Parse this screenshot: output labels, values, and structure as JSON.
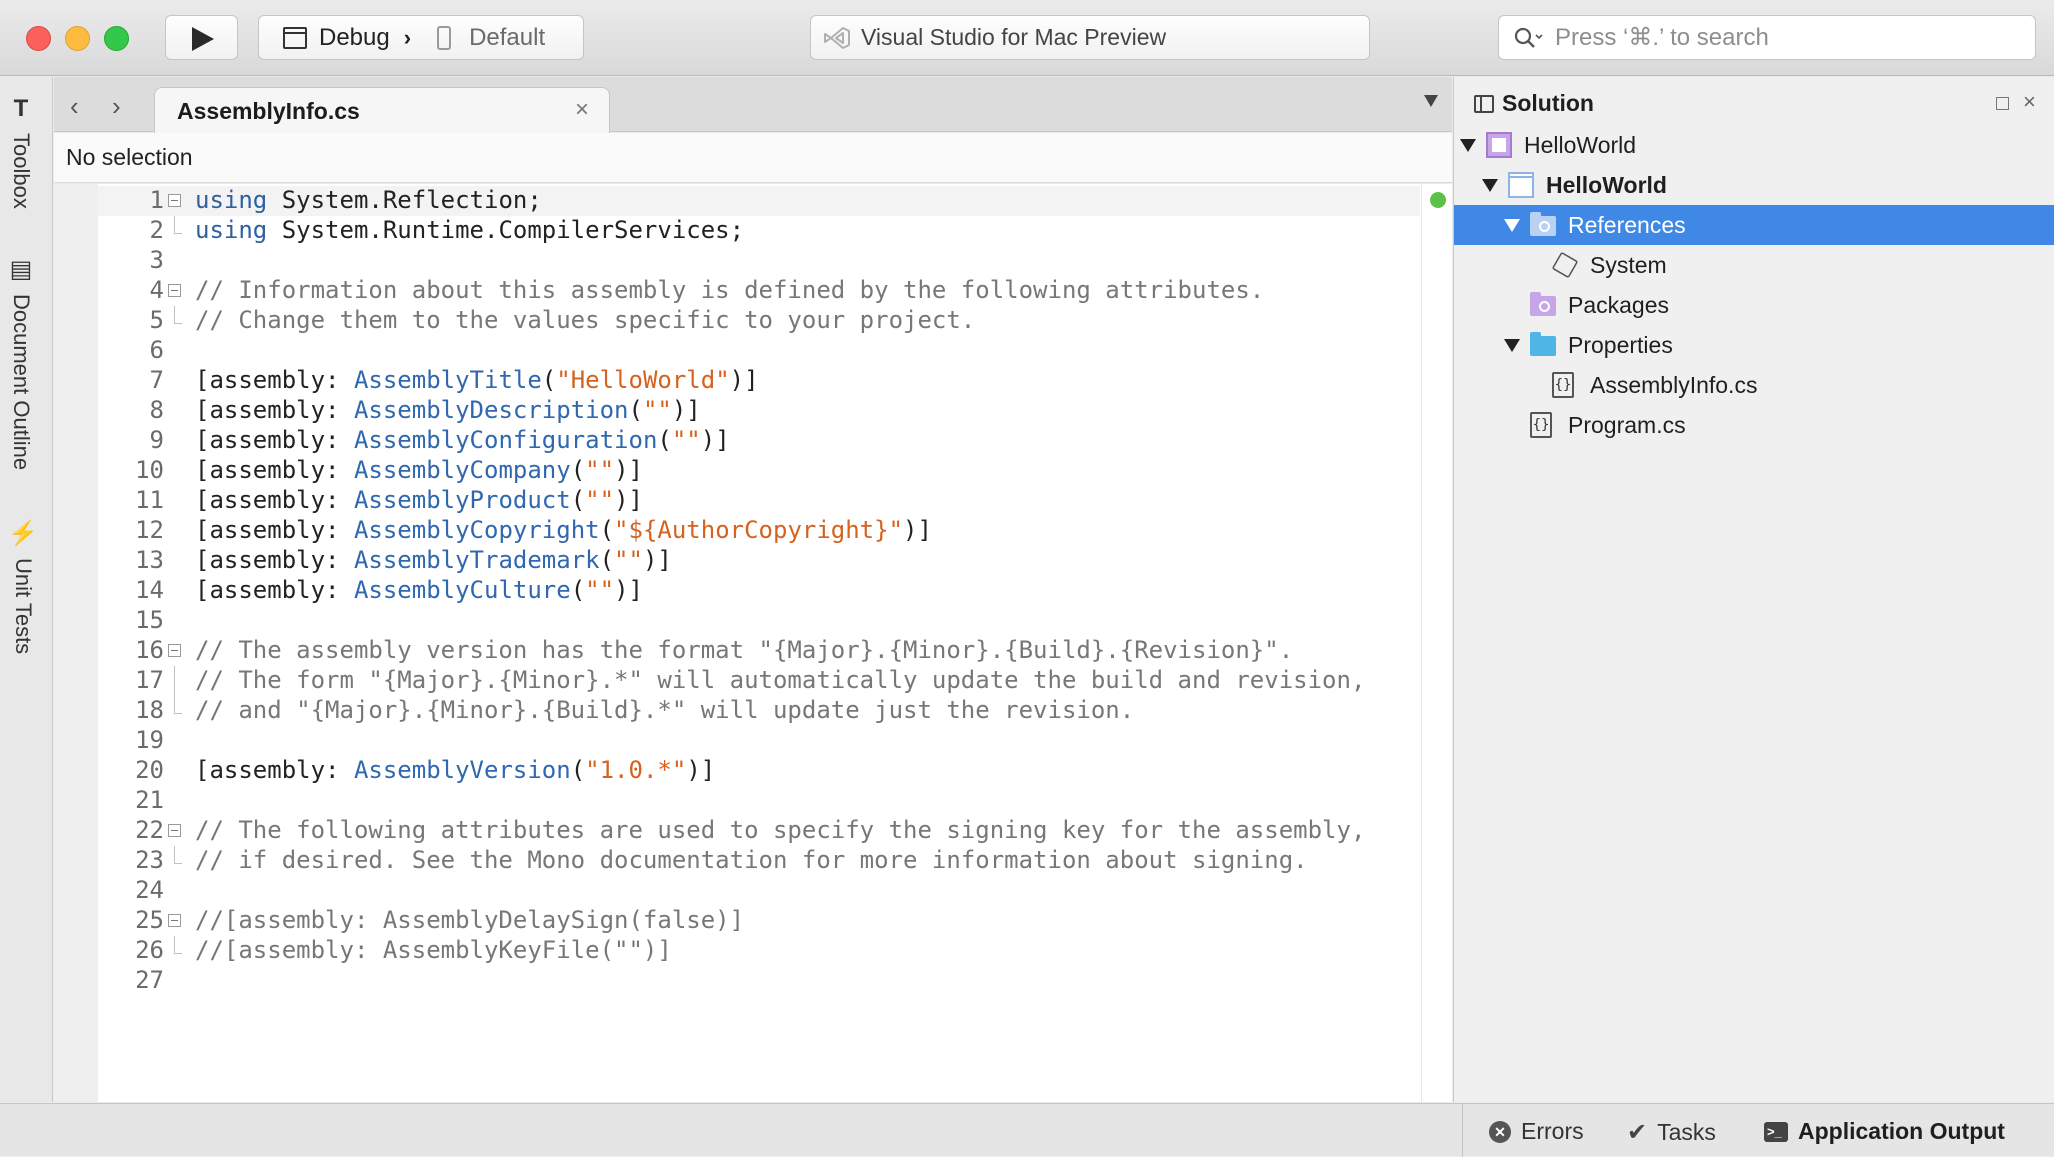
{
  "toolbar": {
    "config": "Debug",
    "config_separator": "›",
    "device": "Default",
    "status": "Visual Studio for Mac Preview",
    "search_placeholder": "Press ‘⌘.’ to search"
  },
  "left_pads": [
    {
      "label": "Toolbox",
      "icon": "toolbox-icon",
      "glyph": "T"
    },
    {
      "label": "Document Outline",
      "icon": "document-outline-icon",
      "glyph": "▤"
    },
    {
      "label": "Unit Tests",
      "icon": "unit-tests-icon",
      "glyph": "⚡"
    }
  ],
  "editor": {
    "nav_back": "‹",
    "nav_forward": "›",
    "tab_label": "AssemblyInfo.cs",
    "tab_close": "×",
    "path": "No selection",
    "lines": [
      {
        "n": "1",
        "fold": "open",
        "parts": [
          [
            "kw",
            "using"
          ],
          [
            "plain",
            " System.Reflection;"
          ]
        ]
      },
      {
        "n": "2",
        "fold": "end",
        "parts": [
          [
            "kw",
            "using"
          ],
          [
            "plain",
            " System.Runtime.CompilerServices;"
          ]
        ]
      },
      {
        "n": "3",
        "fold": "",
        "parts": []
      },
      {
        "n": "4",
        "fold": "open",
        "parts": [
          [
            "cmt",
            "// Information about this assembly is defined by the following attributes."
          ]
        ]
      },
      {
        "n": "5",
        "fold": "end",
        "parts": [
          [
            "cmt",
            "// Change them to the values specific to your project."
          ]
        ]
      },
      {
        "n": "6",
        "fold": "",
        "parts": []
      },
      {
        "n": "7",
        "fold": "",
        "parts": [
          [
            "plain",
            "[assembly: "
          ],
          [
            "typ",
            "AssemblyTitle"
          ],
          [
            "plain",
            "("
          ],
          [
            "str",
            "\"HelloWorld\""
          ],
          [
            "plain",
            ")]"
          ]
        ]
      },
      {
        "n": "8",
        "fold": "",
        "parts": [
          [
            "plain",
            "[assembly: "
          ],
          [
            "typ",
            "AssemblyDescription"
          ],
          [
            "plain",
            "("
          ],
          [
            "str",
            "\"\""
          ],
          [
            "plain",
            ")]"
          ]
        ]
      },
      {
        "n": "9",
        "fold": "",
        "parts": [
          [
            "plain",
            "[assembly: "
          ],
          [
            "typ",
            "AssemblyConfiguration"
          ],
          [
            "plain",
            "("
          ],
          [
            "str",
            "\"\""
          ],
          [
            "plain",
            ")]"
          ]
        ]
      },
      {
        "n": "10",
        "fold": "",
        "parts": [
          [
            "plain",
            "[assembly: "
          ],
          [
            "typ",
            "AssemblyCompany"
          ],
          [
            "plain",
            "("
          ],
          [
            "str",
            "\"\""
          ],
          [
            "plain",
            ")]"
          ]
        ]
      },
      {
        "n": "11",
        "fold": "",
        "parts": [
          [
            "plain",
            "[assembly: "
          ],
          [
            "typ",
            "AssemblyProduct"
          ],
          [
            "plain",
            "("
          ],
          [
            "str",
            "\"\""
          ],
          [
            "plain",
            ")]"
          ]
        ]
      },
      {
        "n": "12",
        "fold": "",
        "parts": [
          [
            "plain",
            "[assembly: "
          ],
          [
            "typ",
            "AssemblyCopyright"
          ],
          [
            "plain",
            "("
          ],
          [
            "str",
            "\"${AuthorCopyright}\""
          ],
          [
            "plain",
            ")]"
          ]
        ]
      },
      {
        "n": "13",
        "fold": "",
        "parts": [
          [
            "plain",
            "[assembly: "
          ],
          [
            "typ",
            "AssemblyTrademark"
          ],
          [
            "plain",
            "("
          ],
          [
            "str",
            "\"\""
          ],
          [
            "plain",
            ")]"
          ]
        ]
      },
      {
        "n": "14",
        "fold": "",
        "parts": [
          [
            "plain",
            "[assembly: "
          ],
          [
            "typ",
            "AssemblyCulture"
          ],
          [
            "plain",
            "("
          ],
          [
            "str",
            "\"\""
          ],
          [
            "plain",
            ")]"
          ]
        ]
      },
      {
        "n": "15",
        "fold": "",
        "parts": []
      },
      {
        "n": "16",
        "fold": "open",
        "parts": [
          [
            "cmt",
            "// The assembly version has the format \"{Major}.{Minor}.{Build}.{Revision}\"."
          ]
        ]
      },
      {
        "n": "17",
        "fold": "mid",
        "parts": [
          [
            "cmt",
            "// The form \"{Major}.{Minor}.*\" will automatically update the build and revision,"
          ]
        ]
      },
      {
        "n": "18",
        "fold": "end",
        "parts": [
          [
            "cmt",
            "// and \"{Major}.{Minor}.{Build}.*\" will update just the revision."
          ]
        ]
      },
      {
        "n": "19",
        "fold": "",
        "parts": []
      },
      {
        "n": "20",
        "fold": "",
        "parts": [
          [
            "plain",
            "[assembly: "
          ],
          [
            "typ",
            "AssemblyVersion"
          ],
          [
            "plain",
            "("
          ],
          [
            "str",
            "\"1.0.*\""
          ],
          [
            "plain",
            ")]"
          ]
        ]
      },
      {
        "n": "21",
        "fold": "",
        "parts": []
      },
      {
        "n": "22",
        "fold": "open",
        "parts": [
          [
            "cmt",
            "// The following attributes are used to specify the signing key for the assembly,"
          ]
        ]
      },
      {
        "n": "23",
        "fold": "end",
        "parts": [
          [
            "cmt",
            "// if desired. See the Mono documentation for more information about signing."
          ]
        ]
      },
      {
        "n": "24",
        "fold": "",
        "parts": []
      },
      {
        "n": "25",
        "fold": "open",
        "parts": [
          [
            "cmt",
            "//[assembly: AssemblyDelaySign(false)]"
          ]
        ]
      },
      {
        "n": "26",
        "fold": "end",
        "parts": [
          [
            "cmt",
            "//[assembly: AssemblyKeyFile(\"\")]"
          ]
        ]
      },
      {
        "n": "27",
        "fold": "",
        "parts": []
      }
    ]
  },
  "solution": {
    "title": "Solution",
    "close": "×",
    "items": [
      {
        "label": "HelloWorld",
        "depth": 0,
        "expanded": true,
        "icon": "solution-icon",
        "bold": false,
        "selected": false
      },
      {
        "label": "HelloWorld",
        "depth": 1,
        "expanded": true,
        "icon": "project-icon",
        "bold": true,
        "selected": false
      },
      {
        "label": "References",
        "depth": 2,
        "expanded": true,
        "icon": "references-folder-icon",
        "bold": false,
        "selected": true
      },
      {
        "label": "System",
        "depth": 3,
        "expanded": null,
        "icon": "assembly-icon",
        "bold": false,
        "selected": false
      },
      {
        "label": "Packages",
        "depth": 2,
        "expanded": null,
        "icon": "packages-folder-icon",
        "bold": false,
        "selected": false
      },
      {
        "label": "Properties",
        "depth": 2,
        "expanded": true,
        "icon": "properties-folder-icon",
        "bold": false,
        "selected": false
      },
      {
        "label": "AssemblyInfo.cs",
        "depth": 3,
        "expanded": null,
        "icon": "csharp-file-icon",
        "bold": false,
        "selected": false
      },
      {
        "label": "Program.cs",
        "depth": 2,
        "expanded": null,
        "icon": "csharp-file-icon",
        "bold": false,
        "selected": false
      }
    ]
  },
  "statusbar": {
    "errors": "Errors",
    "tasks": "Tasks",
    "output": "Application Output"
  },
  "colors": {
    "selection": "#3f88e6",
    "keyword": "#2f5f9e",
    "type": "#3068b0",
    "string": "#d5621f",
    "comment": "#777777"
  }
}
